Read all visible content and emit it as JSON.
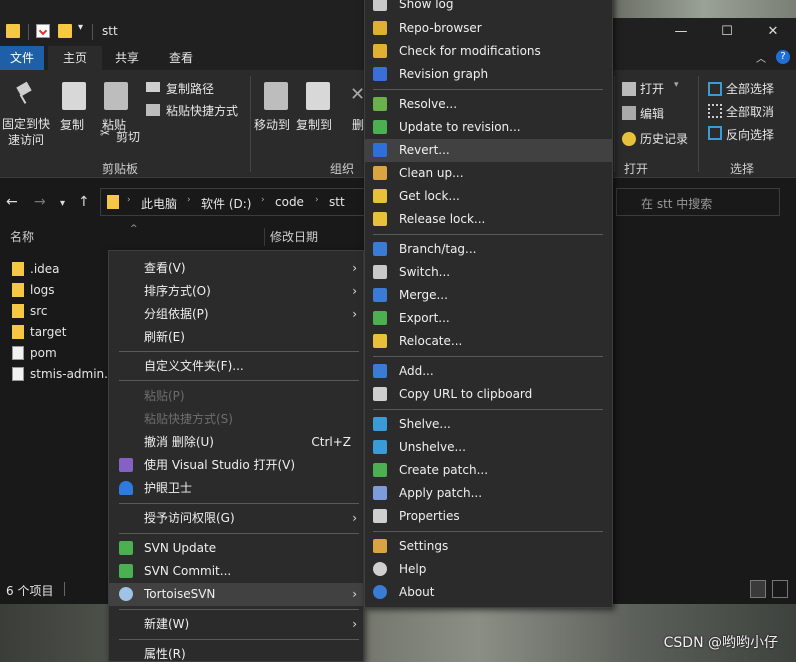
{
  "window": {
    "title": "stt",
    "controls": {
      "minimize": "—",
      "maximize": "☐",
      "close": "✕"
    }
  },
  "ribbon_tabs": [
    "文件",
    "主页",
    "共享",
    "查看"
  ],
  "ribbon": {
    "pin_label": "固定到快\n速访问",
    "copy_label": "复制",
    "paste_label": "粘贴",
    "copy_path_label": "复制路径",
    "paste_shortcut_label": "粘贴快捷方式",
    "cut_label": "剪切",
    "clipboard_group": "剪贴板",
    "move_to_label": "移动到",
    "copy_to_label": "复制到",
    "delete_label": "删",
    "organize_group": "组织",
    "open_label": "打开",
    "edit_label": "编辑",
    "history_label": "历史记录",
    "open_group": "打开",
    "select_all_label": "全部选择",
    "select_none_label": "全部取消",
    "invert_selection_label": "反向选择",
    "select_group": "选择"
  },
  "address": {
    "breadcrumbs": [
      "此电脑",
      "软件 (D:)",
      "code",
      "stt"
    ],
    "search_placeholder": "在 stt 中搜索"
  },
  "columns": {
    "name": "名称",
    "modified": "修改日期"
  },
  "files": [
    {
      "name": ".idea",
      "type": "folder"
    },
    {
      "name": "logs",
      "type": "folder"
    },
    {
      "name": "src",
      "type": "folder"
    },
    {
      "name": "target",
      "type": "folder"
    },
    {
      "name": "pom",
      "type": "file"
    },
    {
      "name": "stmis-admin.i",
      "type": "file"
    }
  ],
  "status": {
    "item_count": "6 个项目"
  },
  "context_menu": {
    "view": "查看(V)",
    "sort": "排序方式(O)",
    "group": "分组依据(P)",
    "refresh": "刷新(E)",
    "customize": "自定义文件夹(F)...",
    "paste": "粘贴(P)",
    "paste_shortcut": "粘贴快捷方式(S)",
    "undo_delete": "撤消 删除(U)",
    "undo_shortcut": "Ctrl+Z",
    "open_vs": "使用 Visual Studio 打开(V)",
    "eye_guard": "护眼卫士",
    "grant_access": "授予访问权限(G)",
    "svn_update": "SVN Update",
    "svn_commit": "SVN Commit...",
    "tortoise": "TortoiseSVN",
    "new": "新建(W)",
    "properties": "属性(R)"
  },
  "tsvn_menu": [
    {
      "label": "Show log",
      "icon": "log-icon",
      "color": "#c9c9c9"
    },
    {
      "label": "Repo-browser",
      "icon": "repo-browser-icon",
      "color": "#e0b030"
    },
    {
      "label": "Check for modifications",
      "icon": "check-modifications-icon",
      "color": "#e0b030"
    },
    {
      "label": "Revision graph",
      "icon": "revision-graph-icon",
      "color": "#3a6fd8"
    },
    {
      "label": "Resolve...",
      "icon": "resolve-icon",
      "color": "#6ab04c"
    },
    {
      "label": "Update to revision...",
      "icon": "update-revision-icon",
      "color": "#4caf50"
    },
    {
      "label": "Revert...",
      "icon": "revert-icon",
      "color": "#2f6fd8"
    },
    {
      "label": "Clean up...",
      "icon": "cleanup-icon",
      "color": "#d9a441"
    },
    {
      "label": "Get lock...",
      "icon": "lock-icon",
      "color": "#e8c13a"
    },
    {
      "label": "Release lock...",
      "icon": "unlock-icon",
      "color": "#e8c13a"
    },
    {
      "label": "Branch/tag...",
      "icon": "branch-icon",
      "color": "#3a7bd5"
    },
    {
      "label": "Switch...",
      "icon": "switch-icon",
      "color": "#c9c9c9"
    },
    {
      "label": "Merge...",
      "icon": "merge-icon",
      "color": "#3a7bd5"
    },
    {
      "label": "Export...",
      "icon": "export-icon",
      "color": "#4caf50"
    },
    {
      "label": "Relocate...",
      "icon": "relocate-icon",
      "color": "#e8c13a"
    },
    {
      "label": "Add...",
      "icon": "add-icon",
      "color": "#3a7bd5"
    },
    {
      "label": "Copy URL to clipboard",
      "icon": "copy-url-icon",
      "color": "#cfcfcf"
    },
    {
      "label": "Shelve...",
      "icon": "shelve-icon",
      "color": "#3a9bd5"
    },
    {
      "label": "Unshelve...",
      "icon": "unshelve-icon",
      "color": "#3a9bd5"
    },
    {
      "label": "Create patch...",
      "icon": "create-patch-icon",
      "color": "#4caf50"
    },
    {
      "label": "Apply patch...",
      "icon": "apply-patch-icon",
      "color": "#7d9cdb"
    },
    {
      "label": "Properties",
      "icon": "properties-icon",
      "color": "#cfcfcf"
    },
    {
      "label": "Settings",
      "icon": "settings-icon",
      "color": "#d9a441"
    },
    {
      "label": "Help",
      "icon": "help-icon",
      "color": "#cfcfcf"
    },
    {
      "label": "About",
      "icon": "about-icon",
      "color": "#3a7bd5"
    }
  ],
  "watermark": "CSDN @哟哟小仔"
}
